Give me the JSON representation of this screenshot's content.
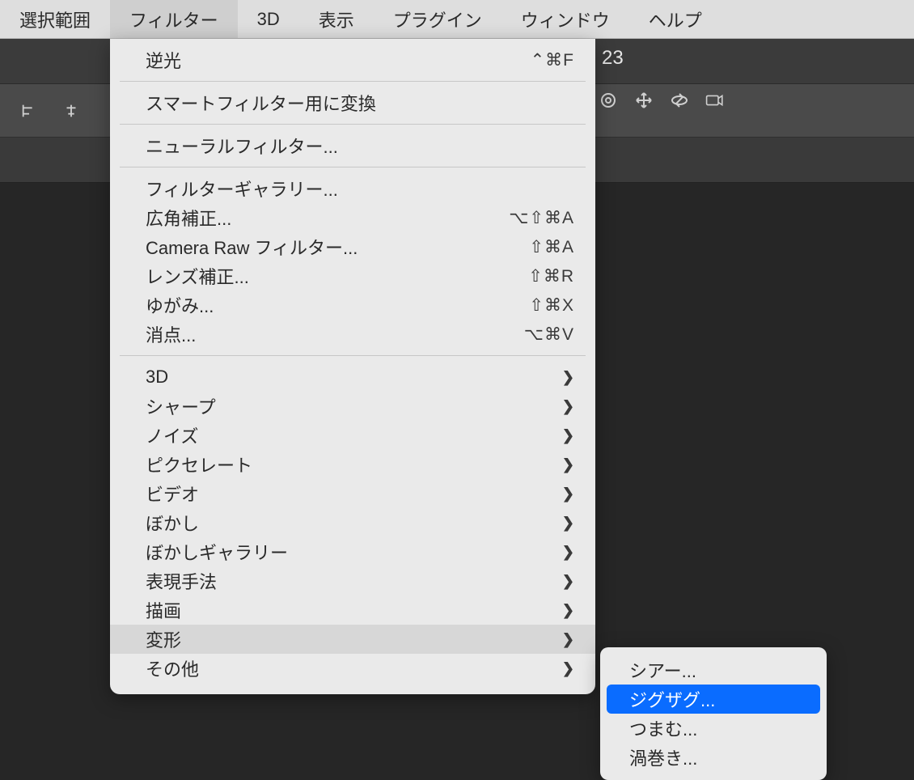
{
  "menubar": {
    "items": [
      "選択範囲",
      "フィルター",
      "3D",
      "表示",
      "プラグイン",
      "ウィンドウ",
      "ヘルプ"
    ],
    "activeIndex": 1
  },
  "app": {
    "title_fragment": "23"
  },
  "filter_menu": {
    "groups": [
      [
        {
          "label": "逆光",
          "shortcut": "⌃⌘F"
        }
      ],
      [
        {
          "label": "スマートフィルター用に変換"
        }
      ],
      [
        {
          "label": "ニューラルフィルター..."
        }
      ],
      [
        {
          "label": "フィルターギャラリー..."
        },
        {
          "label": "広角補正...",
          "shortcut": "⌥⇧⌘A"
        },
        {
          "label": "Camera Raw フィルター...",
          "shortcut": "⇧⌘A"
        },
        {
          "label": "レンズ補正...",
          "shortcut": "⇧⌘R"
        },
        {
          "label": "ゆがみ...",
          "shortcut": "⇧⌘X"
        },
        {
          "label": "消点...",
          "shortcut": "⌥⌘V"
        }
      ],
      [
        {
          "label": "3D",
          "submenu": true
        },
        {
          "label": "シャープ",
          "submenu": true
        },
        {
          "label": "ノイズ",
          "submenu": true
        },
        {
          "label": "ピクセレート",
          "submenu": true
        },
        {
          "label": "ビデオ",
          "submenu": true
        },
        {
          "label": "ぼかし",
          "submenu": true
        },
        {
          "label": "ぼかしギャラリー",
          "submenu": true
        },
        {
          "label": "表現手法",
          "submenu": true
        },
        {
          "label": "描画",
          "submenu": true
        },
        {
          "label": "変形",
          "submenu": true,
          "hovered": true
        },
        {
          "label": "その他",
          "submenu": true
        }
      ]
    ]
  },
  "distort_submenu": {
    "items": [
      {
        "label": "シアー..."
      },
      {
        "label": "ジグザグ...",
        "selected": true
      },
      {
        "label": "つまむ..."
      },
      {
        "label": "渦巻き..."
      }
    ]
  }
}
